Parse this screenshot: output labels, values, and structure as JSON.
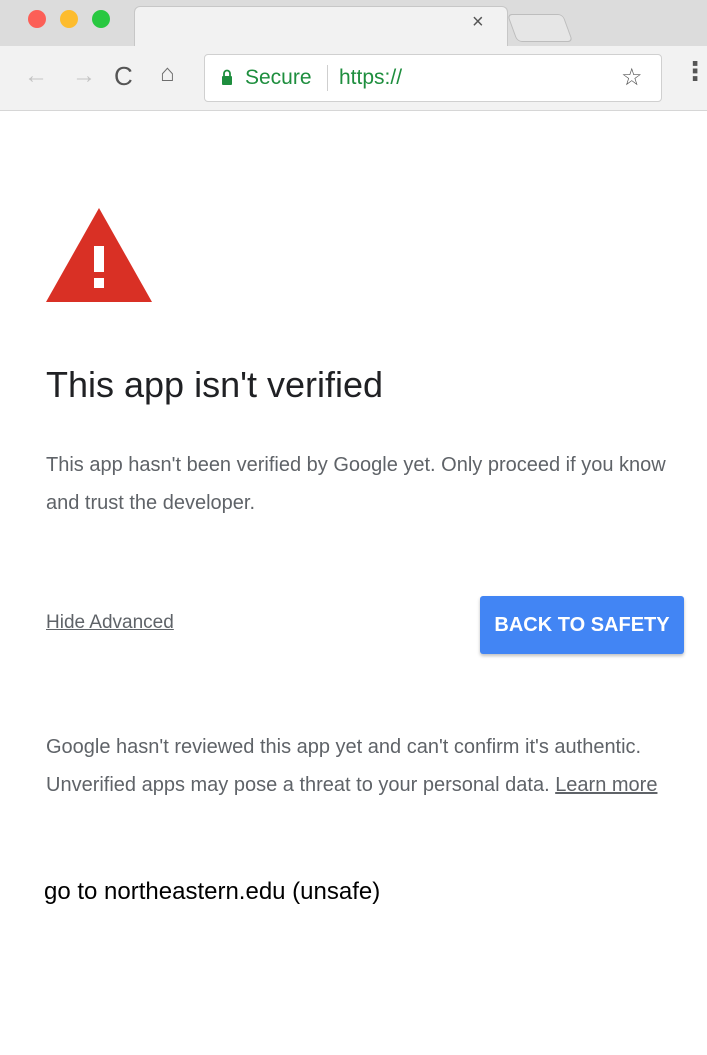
{
  "browser": {
    "tab_close_glyph": "×",
    "nav": {
      "back_glyph": "←",
      "forward_glyph": "→",
      "reload_glyph": "C",
      "home_glyph": "⌂"
    },
    "omnibox": {
      "secure_label": "Secure",
      "url": "https://"
    },
    "star_glyph": "☆",
    "menu_glyph": "⋮"
  },
  "icons": {
    "warning": "warning-triangle-icon",
    "lock": "lock-icon"
  },
  "colors": {
    "warning_red": "#d93025",
    "secure_green": "#1e8e3e",
    "button_blue": "#4285f4"
  },
  "page": {
    "title": "This app isn't verified",
    "intro": "This app hasn't been verified by Google yet. Only proceed if you know and trust the developer.",
    "hide_advanced": "Hide Advanced",
    "back_to_safety": "BACK TO SAFETY",
    "advanced_text": "Google hasn't reviewed this app yet and can't confirm it's authentic. Unverified apps may pose a threat to your personal data.",
    "learn_more": "Learn more",
    "proceed_link": "go to northeastern.edu (unsafe)"
  }
}
